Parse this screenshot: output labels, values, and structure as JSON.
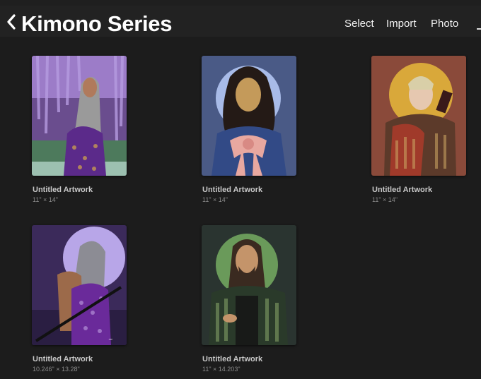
{
  "header": {
    "title": "Kimono Series",
    "select_label": "Select",
    "import_label": "Import",
    "photo_label": "Photo"
  },
  "artworks": [
    {
      "title": "Untitled Artwork",
      "size": "11\" × 14\""
    },
    {
      "title": "Untitled Artwork",
      "size": "11\" × 14\""
    },
    {
      "title": "Untitled Artwork",
      "size": "11\" × 14\""
    },
    {
      "title": "Untitled Artwork",
      "size": "10.246\" × 13.28\""
    },
    {
      "title": "Untitled Artwork",
      "size": "11\" × 14.203\""
    }
  ],
  "colors": {
    "background": "#1c1c1c",
    "topbar": "#222222",
    "title_text": "#ffffff",
    "caption_text": "#c8c8c8",
    "size_text": "#8a8a8a"
  }
}
